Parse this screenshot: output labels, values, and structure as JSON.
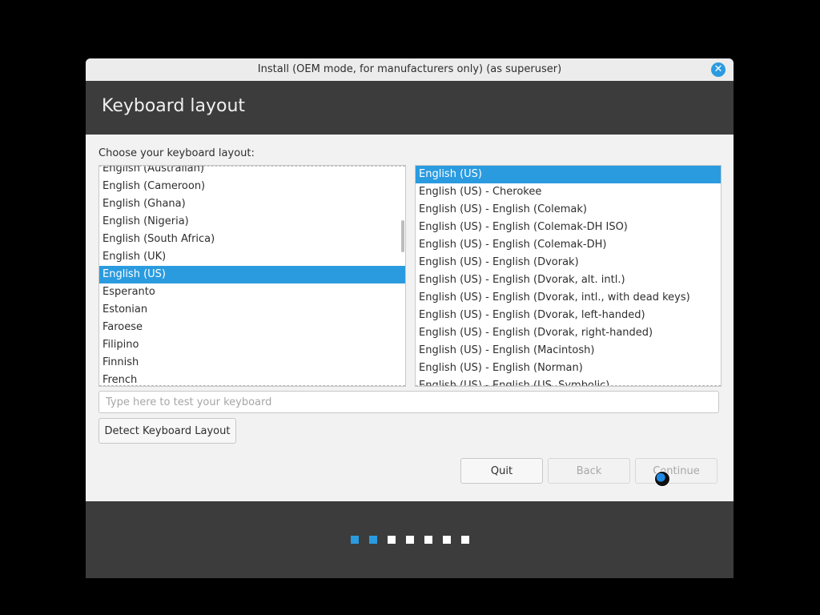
{
  "window": {
    "title": "Install (OEM mode, for manufacturers only) (as superuser)",
    "close_glyph": "✕"
  },
  "header": {
    "title": "Keyboard layout"
  },
  "content": {
    "prompt": "Choose your keyboard layout:",
    "layouts": [
      {
        "label": "English (Australian)",
        "selected": false
      },
      {
        "label": "English (Cameroon)",
        "selected": false
      },
      {
        "label": "English (Ghana)",
        "selected": false
      },
      {
        "label": "English (Nigeria)",
        "selected": false
      },
      {
        "label": "English (South Africa)",
        "selected": false
      },
      {
        "label": "English (UK)",
        "selected": false
      },
      {
        "label": "English (US)",
        "selected": true
      },
      {
        "label": "Esperanto",
        "selected": false
      },
      {
        "label": "Estonian",
        "selected": false
      },
      {
        "label": "Faroese",
        "selected": false
      },
      {
        "label": "Filipino",
        "selected": false
      },
      {
        "label": "Finnish",
        "selected": false
      },
      {
        "label": "French",
        "selected": false
      }
    ],
    "variants": [
      {
        "label": "English (US)",
        "selected": true
      },
      {
        "label": "English (US) - Cherokee",
        "selected": false
      },
      {
        "label": "English (US) - English (Colemak)",
        "selected": false
      },
      {
        "label": "English (US) - English (Colemak-DH ISO)",
        "selected": false
      },
      {
        "label": "English (US) - English (Colemak-DH)",
        "selected": false
      },
      {
        "label": "English (US) - English (Dvorak)",
        "selected": false
      },
      {
        "label": "English (US) - English (Dvorak, alt. intl.)",
        "selected": false
      },
      {
        "label": "English (US) - English (Dvorak, intl., with dead keys)",
        "selected": false
      },
      {
        "label": "English (US) - English (Dvorak, left-handed)",
        "selected": false
      },
      {
        "label": "English (US) - English (Dvorak, right-handed)",
        "selected": false
      },
      {
        "label": "English (US) - English (Macintosh)",
        "selected": false
      },
      {
        "label": "English (US) - English (Norman)",
        "selected": false
      },
      {
        "label": "English (US) - English (US, Symbolic)",
        "selected": false
      }
    ],
    "test_input": {
      "value": "",
      "placeholder": "Type here to test your keyboard"
    },
    "detect_button": "Detect Keyboard Layout"
  },
  "buttons": {
    "quit": "Quit",
    "back": "Back",
    "continue": "Continue"
  },
  "progress": {
    "total_steps": 7,
    "completed_steps": 2
  },
  "colors": {
    "accent": "#2b9be0",
    "header_bg": "#3c3c3c",
    "window_bg": "#f2f2f2"
  }
}
